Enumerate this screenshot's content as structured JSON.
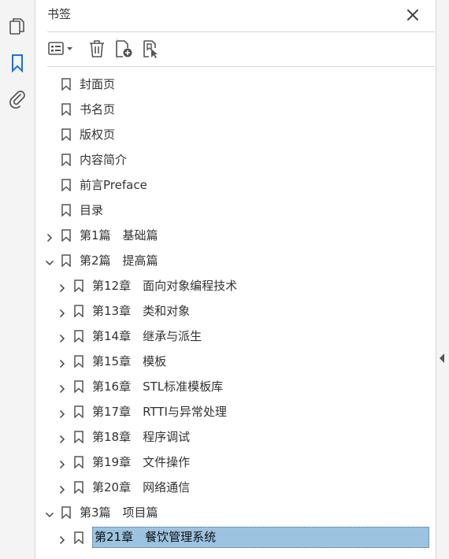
{
  "panel": {
    "title": "书签"
  },
  "colors": {
    "accent": "#1473e6",
    "selection": "#9cc3e0"
  },
  "left_rail": {
    "icons": [
      "pages-icon",
      "bookmark-icon",
      "attachment-icon"
    ]
  },
  "toolbar": {
    "icons": [
      "options-menu-icon",
      "delete-icon",
      "new-bookmark-icon",
      "bookmark-from-selection-icon"
    ]
  },
  "bookmarks": [
    {
      "label": "封面页",
      "level": 0,
      "expand": "none"
    },
    {
      "label": "书名页",
      "level": 0,
      "expand": "none"
    },
    {
      "label": "版权页",
      "level": 0,
      "expand": "none"
    },
    {
      "label": "内容简介",
      "level": 0,
      "expand": "none"
    },
    {
      "label": "前言Preface",
      "level": 0,
      "expand": "none"
    },
    {
      "label": "目录",
      "level": 0,
      "expand": "none"
    },
    {
      "label": "第1篇　基础篇",
      "level": 0,
      "expand": "collapsed"
    },
    {
      "label": "第2篇　提高篇",
      "level": 0,
      "expand": "expanded"
    },
    {
      "label": "第12章　面向对象编程技术",
      "level": 1,
      "expand": "collapsed"
    },
    {
      "label": "第13章　类和对象",
      "level": 1,
      "expand": "collapsed"
    },
    {
      "label": "第14章　继承与派生",
      "level": 1,
      "expand": "collapsed"
    },
    {
      "label": "第15章　模板",
      "level": 1,
      "expand": "collapsed"
    },
    {
      "label": "第16章　STL标准模板库",
      "level": 1,
      "expand": "collapsed"
    },
    {
      "label": "第17章　RTTI与异常处理",
      "level": 1,
      "expand": "collapsed"
    },
    {
      "label": "第18章　程序调试",
      "level": 1,
      "expand": "collapsed"
    },
    {
      "label": "第19章　文件操作",
      "level": 1,
      "expand": "collapsed"
    },
    {
      "label": "第20章　网络通信",
      "level": 1,
      "expand": "collapsed"
    },
    {
      "label": "第3篇　项目篇",
      "level": 0,
      "expand": "expanded"
    },
    {
      "label": "第21章　餐饮管理系统",
      "level": 1,
      "expand": "collapsed",
      "selected": true
    }
  ]
}
